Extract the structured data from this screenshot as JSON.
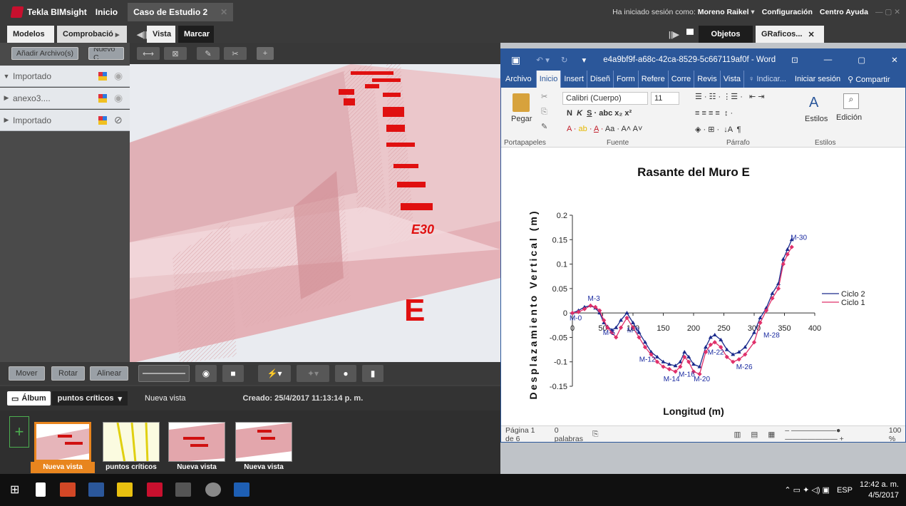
{
  "app": {
    "name": "Tekla BIMsight",
    "menu_home": "Inicio",
    "tab_case": "Caso de Estudio 2",
    "session_prefix": "Ha iniciado sesión como:",
    "user": "Moreno Raikel",
    "config": "Configuración",
    "help": "Centro Ayuda"
  },
  "left_tabs": {
    "models": "Modelos",
    "check": "Comprobació",
    "view": "Vista",
    "mark": "Marcar"
  },
  "right_tabs": {
    "objects": "Objetos",
    "graphics": "GRaficos..."
  },
  "left_buttons": {
    "add_file": "Añadir Archivo(s)",
    "new": "Nuevo C"
  },
  "models": [
    {
      "name": "Importado",
      "expanded": true
    },
    {
      "name": "anexo3....",
      "expanded": false
    },
    {
      "name": "Importado",
      "expanded": false
    }
  ],
  "bottom_buttons": {
    "move": "Mover",
    "rotate": "Rotar",
    "align": "Alinear"
  },
  "album": {
    "label": "Álbum",
    "selector": "puntos críticos",
    "view_name": "Nueva vista",
    "created": "Creado: 25/4/2017 11:13:14 p. m.",
    "thumbs": [
      "Nueva vista",
      "puntos críticos",
      "Nueva vista",
      "Nueva vista"
    ]
  },
  "viewport": {
    "label_e30": "E30",
    "label_e": "E"
  },
  "word": {
    "filename": "e4a9bf9f-a68c-42ca-8529-5c667119af0f - Word",
    "tabs": [
      "Archivo",
      "Inicio",
      "Insert",
      "Diseñ",
      "Form",
      "Refere",
      "Corre",
      "Revis",
      "Vista"
    ],
    "tell_me": "Indicar...",
    "signin": "Iniciar sesión",
    "share": "Compartir",
    "font": "Calibri (Cuerpo)",
    "size": "11",
    "paste": "Pegar",
    "styles": "Estilos",
    "edit": "Edición",
    "groups": [
      "Portapapeles",
      "Fuente",
      "Párrafo",
      "Estilos"
    ],
    "status": {
      "page": "Página 1 de 6",
      "words": "0 palabras",
      "zoom": "100 %"
    }
  },
  "chart_data": {
    "type": "line",
    "title": "Rasante del Muro E",
    "xlabel": "Longitud (m)",
    "ylabel": "Desplazamiento Vertical (m)",
    "xlim": [
      0,
      400
    ],
    "ylim": [
      -0.15,
      0.2
    ],
    "xticks": [
      0,
      50,
      100,
      150,
      200,
      250,
      300,
      350,
      400
    ],
    "yticks": [
      -0.15,
      -0.1,
      -0.05,
      0,
      0.05,
      0.1,
      0.15,
      0.2
    ],
    "series": [
      {
        "name": "Ciclo 2",
        "color": "#1a2a8c",
        "x": [
          0,
          10,
          20,
          30,
          38,
          45,
          52,
          58,
          65,
          72,
          80,
          90,
          100,
          110,
          120,
          130,
          140,
          150,
          160,
          170,
          178,
          185,
          192,
          200,
          210,
          220,
          228,
          235,
          245,
          255,
          265,
          275,
          285,
          300,
          310,
          320,
          330,
          340,
          348,
          355,
          362
        ],
        "y": [
          0,
          0.005,
          0.012,
          0.015,
          0.01,
          0,
          -0.02,
          -0.028,
          -0.035,
          -0.03,
          -0.015,
          0,
          -0.02,
          -0.04,
          -0.06,
          -0.08,
          -0.09,
          -0.1,
          -0.105,
          -0.108,
          -0.1,
          -0.08,
          -0.09,
          -0.105,
          -0.11,
          -0.07,
          -0.05,
          -0.045,
          -0.055,
          -0.075,
          -0.085,
          -0.08,
          -0.07,
          -0.04,
          -0.01,
          0.01,
          0.04,
          0.06,
          0.11,
          0.13,
          0.15
        ]
      },
      {
        "name": "Ciclo 1",
        "color": "#e0306a",
        "x": [
          0,
          10,
          20,
          30,
          38,
          45,
          52,
          58,
          65,
          72,
          80,
          90,
          100,
          110,
          120,
          130,
          140,
          150,
          160,
          170,
          178,
          185,
          192,
          200,
          210,
          220,
          228,
          235,
          245,
          255,
          265,
          275,
          285,
          300,
          310,
          320,
          330,
          340,
          348,
          355,
          362
        ],
        "y": [
          0,
          0.002,
          0.008,
          0.015,
          0.012,
          0.005,
          -0.015,
          -0.03,
          -0.04,
          -0.05,
          -0.03,
          -0.01,
          -0.03,
          -0.05,
          -0.07,
          -0.085,
          -0.1,
          -0.11,
          -0.115,
          -0.12,
          -0.11,
          -0.09,
          -0.1,
          -0.12,
          -0.125,
          -0.08,
          -0.065,
          -0.06,
          -0.07,
          -0.09,
          -0.1,
          -0.095,
          -0.085,
          -0.06,
          -0.02,
          0.005,
          0.03,
          0.05,
          0.1,
          0.12,
          0.135
        ]
      }
    ],
    "annotations": [
      "M-0",
      "M-3",
      "M-5",
      "M-9",
      "M-12",
      "M-14",
      "M-16",
      "M-20",
      "M-22",
      "M-26",
      "M-28",
      "M-30"
    ]
  },
  "taskbar": {
    "lang": "ESP",
    "time": "12:42 a. m.",
    "date": "4/5/2017"
  }
}
